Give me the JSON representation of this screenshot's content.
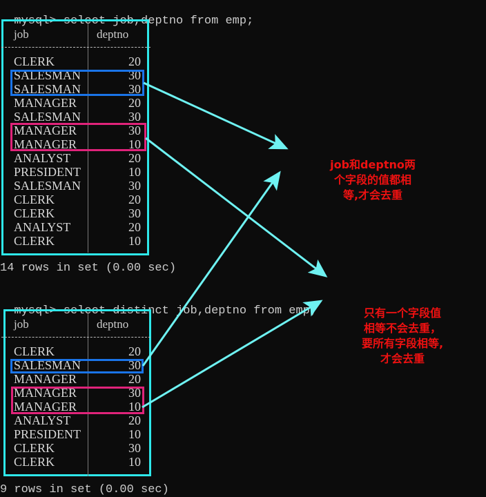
{
  "terminal": {
    "query1": {
      "prompt": "mysql>",
      "command": "select job,deptno from emp;",
      "columns": [
        "job",
        "deptno"
      ],
      "rows": [
        {
          "job": "CLERK",
          "deptno": "20"
        },
        {
          "job": "SALESMAN",
          "deptno": "30"
        },
        {
          "job": "SALESMAN",
          "deptno": "30"
        },
        {
          "job": "MANAGER",
          "deptno": "20"
        },
        {
          "job": "SALESMAN",
          "deptno": "30"
        },
        {
          "job": "MANAGER",
          "deptno": "30"
        },
        {
          "job": "MANAGER",
          "deptno": "10"
        },
        {
          "job": "ANALYST",
          "deptno": "20"
        },
        {
          "job": "PRESIDENT",
          "deptno": "10"
        },
        {
          "job": "SALESMAN",
          "deptno": "30"
        },
        {
          "job": "CLERK",
          "deptno": "20"
        },
        {
          "job": "CLERK",
          "deptno": "30"
        },
        {
          "job": "ANALYST",
          "deptno": "20"
        },
        {
          "job": "CLERK",
          "deptno": "10"
        }
      ],
      "footer": "14 rows in set (0.00 sec)"
    },
    "query2": {
      "prompt": "mysql>",
      "command": "select distinct job,deptno from emp;",
      "columns": [
        "job",
        "deptno"
      ],
      "rows": [
        {
          "job": "CLERK",
          "deptno": "20"
        },
        {
          "job": "SALESMAN",
          "deptno": "30"
        },
        {
          "job": "MANAGER",
          "deptno": "20"
        },
        {
          "job": "MANAGER",
          "deptno": "30"
        },
        {
          "job": "MANAGER",
          "deptno": "10"
        },
        {
          "job": "ANALYST",
          "deptno": "20"
        },
        {
          "job": "PRESIDENT",
          "deptno": "10"
        },
        {
          "job": "CLERK",
          "deptno": "30"
        },
        {
          "job": "CLERK",
          "deptno": "10"
        }
      ],
      "footer": "9 rows in set (0.00 sec)"
    }
  },
  "annotations": {
    "note1": [
      "job和deptno两",
      "个字段的值都相",
      "等,才会去重"
    ],
    "note2": [
      "只有一个字段值",
      "相等不会去重，",
      "要所有字段相等,",
      "才会去重"
    ]
  },
  "colors": {
    "background": "#0c0c0c",
    "frame": "#2ee8ea",
    "highlight_blue": "#1a74e8",
    "highlight_pink": "#e0237a",
    "arrow": "#6ef2f2",
    "note_text": "#ee1111"
  }
}
